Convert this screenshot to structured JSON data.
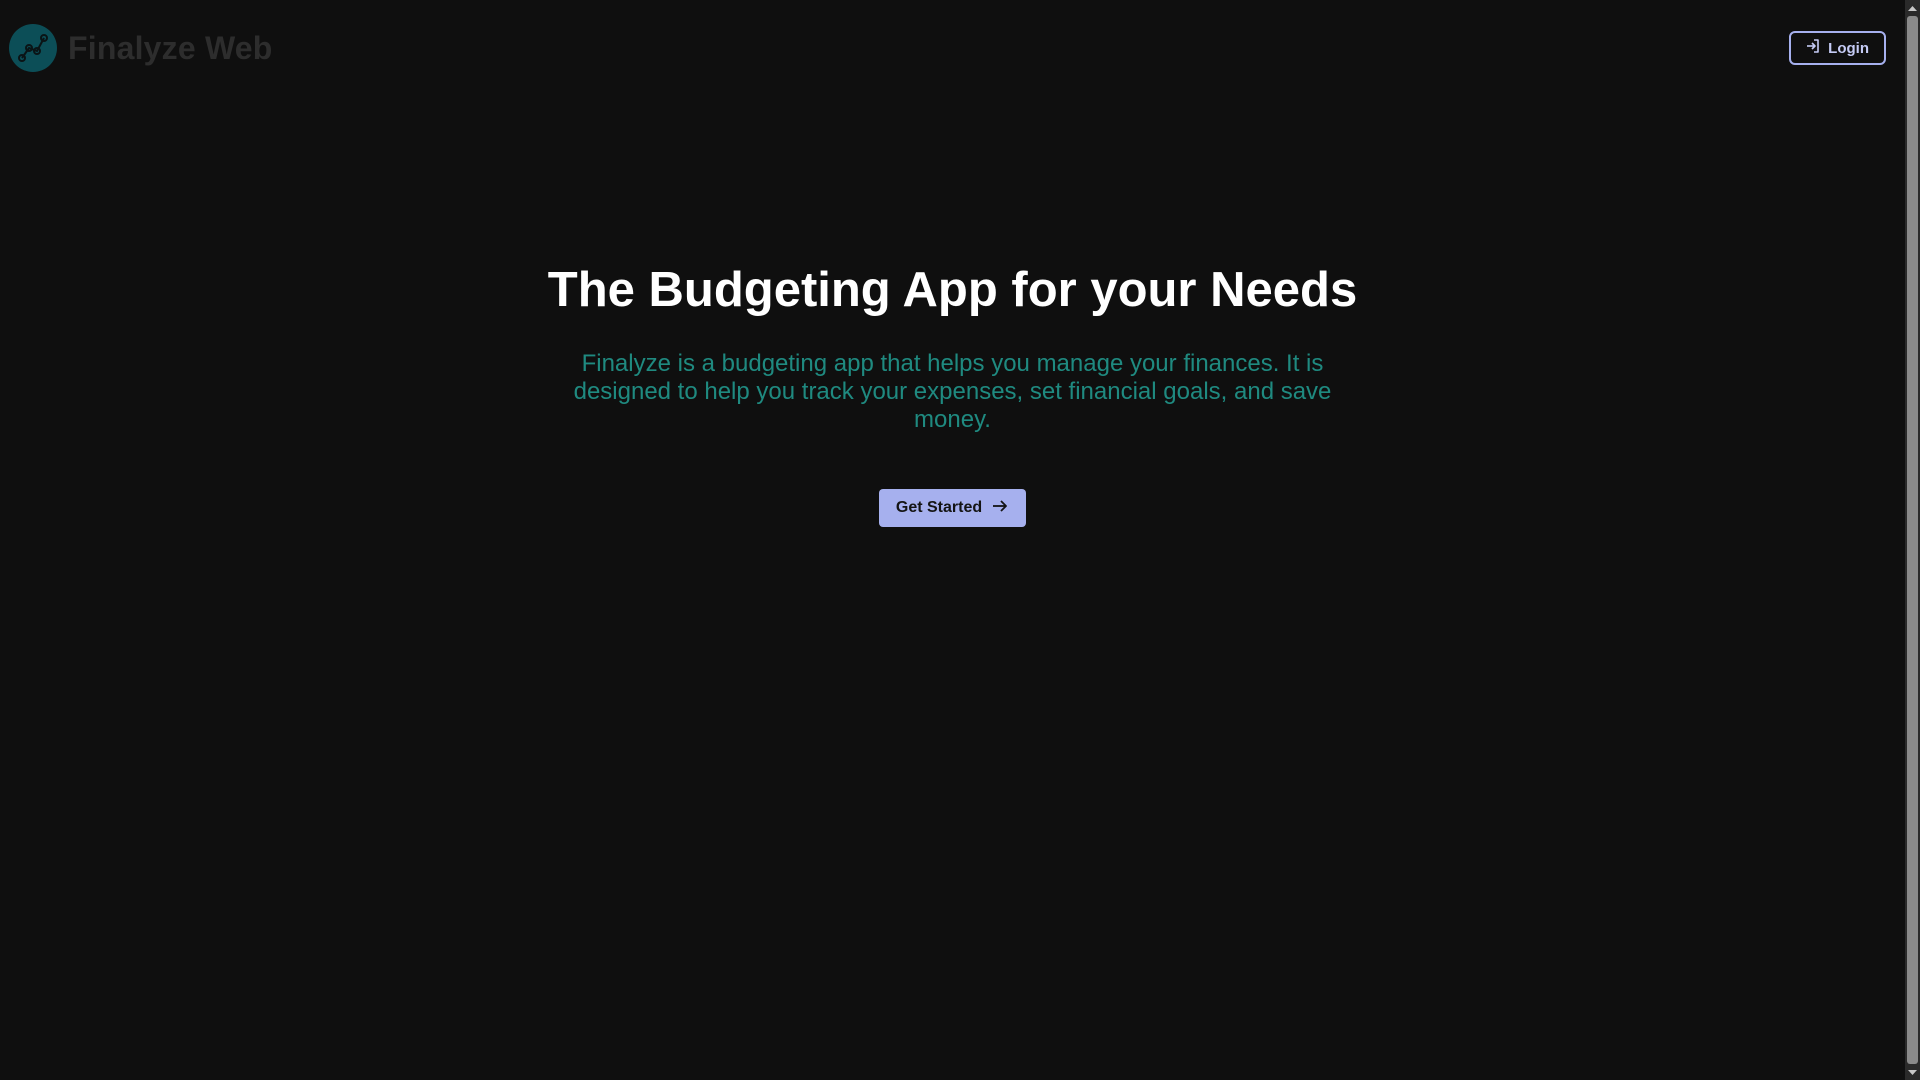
{
  "header": {
    "brand_name": "Finalyze Web",
    "logo_icon": "chart-line-icon",
    "login_label": "Login",
    "login_icon": "sign-in-icon"
  },
  "hero": {
    "title": "The Budgeting App for your Needs",
    "description": "Finalyze is a budgeting app that helps you manage your finances. It is designed to help you track your expenses, set financial goals, and save money.",
    "cta_label": "Get Started",
    "cta_icon": "arrow-right-icon"
  },
  "colors": {
    "background": "#0f0f0f",
    "accent": "#a6b0ee",
    "teal_text": "#1f8a80",
    "logo_bg": "#0c4e57",
    "brand_text": "#2d2d2d"
  }
}
